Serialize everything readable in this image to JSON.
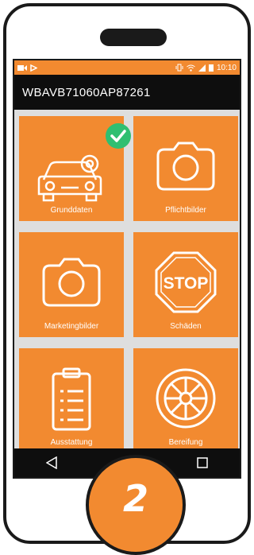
{
  "status_bar": {
    "time": "10:10"
  },
  "app_bar": {
    "title": "WBAVB71060AP87261"
  },
  "tiles": [
    {
      "label": "Grunddaten",
      "icon": "car-gear-icon",
      "completed": true
    },
    {
      "label": "Pflichtbilder",
      "icon": "camera-icon"
    },
    {
      "label": "Marketingbilder",
      "icon": "camera-icon"
    },
    {
      "label": "Schäden",
      "icon": "stop-sign-icon",
      "sign_text": "STOP"
    },
    {
      "label": "Ausstattung",
      "icon": "clipboard-icon"
    },
    {
      "label": "Bereifung",
      "icon": "tire-icon"
    }
  ],
  "step_badge": "2",
  "colors": {
    "accent": "#f28a30",
    "dark": "#0e0e0e",
    "check": "#2fbf71"
  }
}
